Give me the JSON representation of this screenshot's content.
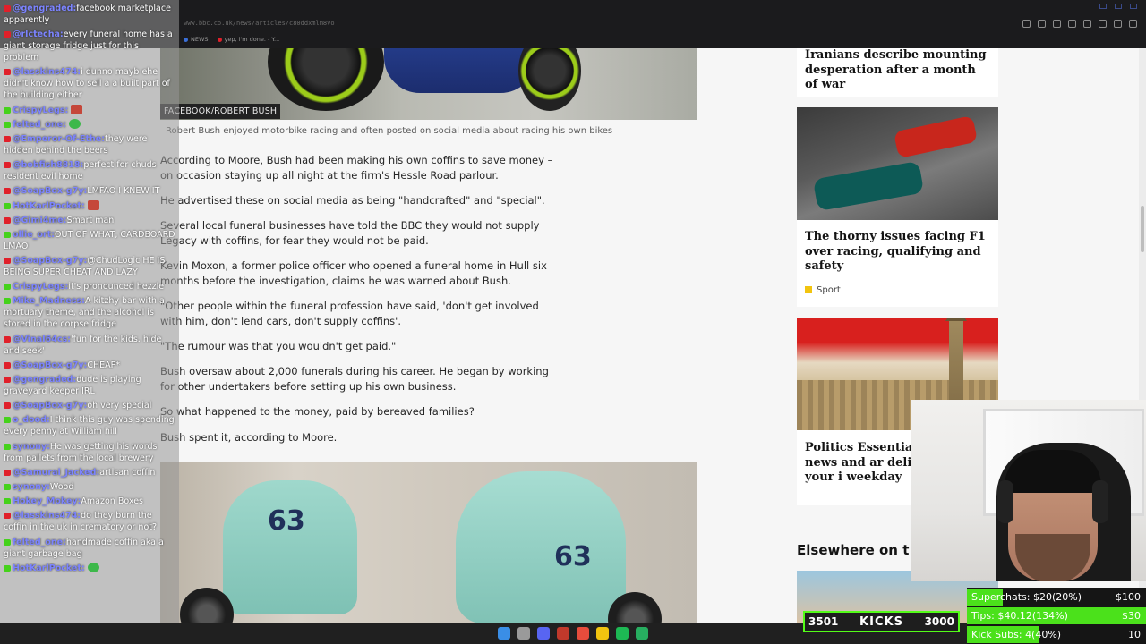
{
  "browser": {
    "address": "www.bbc.co.uk/news/articles/c80ddxmlm8vo",
    "bookmarks": [
      {
        "label": "NEWS",
        "color": "#3a6fd8"
      },
      {
        "label": "yep, i'm done. - Y...",
        "color": "#e0202a"
      }
    ]
  },
  "article": {
    "image_credit": "FACEBOOK/ROBERT BUSH",
    "caption": "Robert Bush enjoyed motorbike racing and often posted on social media about racing his own bikes",
    "paragraphs": [
      "According to Moore, Bush had been making his own coffins to save money – on occasion staying up all night at the firm's Hessle Road parlour.",
      "He advertised these on social media as being \"handcrafted\" and \"special\".",
      "Several local funeral businesses have told the BBC they would not supply Legacy with coffins, for fear they would not be paid.",
      "Kevin Moxon, a former police officer who opened a funeral home in Hull six months before the investigation, claims he was warned about Bush.",
      "\"Other people within the funeral profession have said, 'don't get involved with him, don't lend cars, don't supply coffins'.",
      "\"The rumour was that you wouldn't get paid.\"",
      "Bush oversaw about 2,000 funerals during his career. He began by working for other undertakers before setting up his own business.",
      "So what happened to the money, paid by bereaved families?",
      "Bush spent it, according to Moore."
    ],
    "bike_numbers": [
      "63",
      "63"
    ]
  },
  "sidebar": {
    "card1_title": "Iranians describe mounting desperation after a month of war",
    "card2_title": "The thorny issues facing F1 over racing, qualifying and safety",
    "card2_tag": "Sport",
    "card3_title": "Politics Essential: latest news and ar delivered to your i weekday",
    "elsewhere_heading": "Elsewhere on t"
  },
  "chat": [
    {
      "platform": "yt",
      "user": "@gengraded:",
      "text": "facebook marketplace apparently"
    },
    {
      "platform": "yt",
      "user": "@rlctecha:",
      "text": "every funeral home has a giant storage fridge just for this problem"
    },
    {
      "platform": "yt",
      "user": "@lasskins474:",
      "text": "i dunno mayb ehe didn't know how to sell a a built part of the building either"
    },
    {
      "platform": "kick",
      "user": "CrispyLegs:",
      "text": "",
      "emote": "red"
    },
    {
      "platform": "kick",
      "user": "felted_one:",
      "text": "",
      "emote": "green"
    },
    {
      "platform": "yt",
      "user": "@Emperor-Of-Ethe:",
      "text": "they were hidden behind the beers"
    },
    {
      "platform": "yt",
      "user": "@bobfish8818:",
      "text": "perfect for chuds resident evil home"
    },
    {
      "platform": "yt",
      "user": "@SoapBox-g7y:",
      "text": "LMFAO I KNEW IT"
    },
    {
      "platform": "kick",
      "user": "HotKarlPocket:",
      "text": "",
      "emote": "red"
    },
    {
      "platform": "yt",
      "user": "@Gimi4me:",
      "text": "Smart man"
    },
    {
      "platform": "kick",
      "user": "ollie_ort:",
      "text": "OUT OF WHAT, CARDBOARD LMAO"
    },
    {
      "platform": "yt",
      "user": "@SoapBox-g7y:",
      "text": "@ChudLogic HE IS BEING SUPER CHEAT AND LAZY"
    },
    {
      "platform": "kick",
      "user": "CrispyLegs:",
      "text": "it's pronounced hezzle"
    },
    {
      "platform": "kick",
      "user": "Mike_Madness:",
      "text": "A kitzhy bar with a mortuary theme, and the alcohol is stored in the corpse fridge"
    },
    {
      "platform": "yt",
      "user": "@VinaI64cs:",
      "text": "'fun for the kids. hide and seek'"
    },
    {
      "platform": "yt",
      "user": "@SoapBox-g7y:",
      "text": "CHEAP*"
    },
    {
      "platform": "yt",
      "user": "@gengraded:",
      "text": "dude is playing graveyard keeper IRL"
    },
    {
      "platform": "yt",
      "user": "@SoapBox-g7y:",
      "text": "oh very special"
    },
    {
      "platform": "kick",
      "user": "o_dood:",
      "text": "I think this guy was spending every penny at William hill"
    },
    {
      "platform": "kick",
      "user": "synony:",
      "text": "He was getting his words from pallets from the local brewery"
    },
    {
      "platform": "yt",
      "user": "@Samurai_Jacked:",
      "text": "artisan coffin"
    },
    {
      "platform": "kick",
      "user": "synony:",
      "text": "Wood"
    },
    {
      "platform": "kick",
      "user": "Hokey_Mokey:",
      "text": "Amazon Boxes"
    },
    {
      "platform": "yt",
      "user": "@lasskins474:",
      "text": "do they burn the coffin in the uk in crematory or not?"
    },
    {
      "platform": "kick",
      "user": "felted_one:",
      "text": "handmade coffin aka a giant garbage bag"
    },
    {
      "platform": "kick",
      "user": "HotKarlPocket:",
      "text": "",
      "emote": "green"
    }
  ],
  "kick_bar": {
    "left": "3501",
    "label": "KICKS",
    "right": "3000"
  },
  "goals": [
    {
      "label": "Superchats:",
      "value": "$20(20%)",
      "target": "$100",
      "progress": 0.2
    },
    {
      "label": "Tips:",
      "value": "$40.12(134%)",
      "target": "$30",
      "progress": 1.0
    },
    {
      "label": "Kick Subs:",
      "value": "4(40%)",
      "target": "10",
      "progress": 0.4
    }
  ],
  "colors": {
    "kick_green": "#53fc18",
    "youtube_red": "#e0202a",
    "chat_user": "#7c84ff",
    "bbc_red": "#d8201e"
  }
}
